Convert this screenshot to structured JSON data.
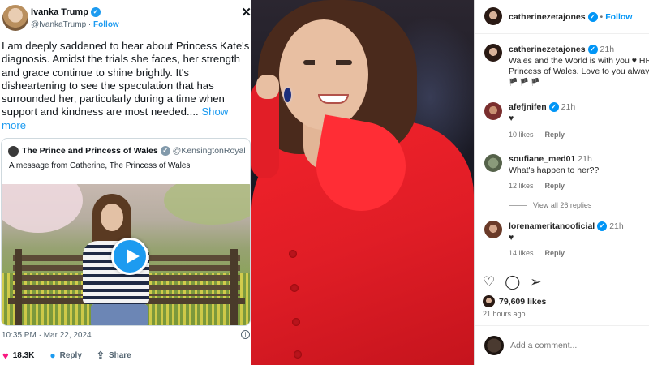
{
  "tweet": {
    "author": "Ivanka Trump",
    "handle": "@IvankaTrump",
    "separator": "·",
    "follow": "Follow",
    "close_icon": "✕",
    "body": "I am deeply saddened to hear about Princess Kate's diagnosis. Amidst the trials she faces, her strength and grace continue to shine brightly. It's disheartening to see the speculation that has surrounded her, particularly during a time when support and kindness are most needed.... ",
    "show_more": "Show more",
    "quote": {
      "author": "The Prince and Princess of Wales",
      "handle": "@KensingtonRoyal",
      "text": "A message from Catherine, The Princess of Wales"
    },
    "timestamp": "10:35 PM · Mar 22, 2024",
    "likes": "18.3K",
    "reply_label": "Reply",
    "share_label": "Share"
  },
  "instagram": {
    "header_user": "catherinezetajones",
    "follow": "Follow",
    "caption": {
      "user": "catherinezetajones",
      "time": "21h",
      "text_lines": [
        "Wales and the World is with you ♥ HRH",
        "Princess of Wales. Love to you always.",
        "🏴 🏴 🏴"
      ]
    },
    "comments": [
      {
        "user": "afefjnifen",
        "verified": true,
        "time": "21h",
        "text": "♥",
        "likes": "10 likes",
        "reply": "Reply"
      },
      {
        "user": "soufiane_med01",
        "verified": false,
        "time": "21h",
        "text": "What's happen to her??",
        "likes": "12 likes",
        "reply": "Reply"
      },
      {
        "user": "lorenameritanooficial",
        "verified": true,
        "time": "21h",
        "text": "♥",
        "likes": "14 likes",
        "reply": "Reply"
      }
    ],
    "view_replies": "View all 26 replies",
    "likes_count": "79,609 likes",
    "posted_ago": "21 hours ago",
    "comment_placeholder": "Add a comment..."
  },
  "colors": {
    "twitter_blue": "#1d9bf0",
    "like_pink": "#f91880",
    "ig_blue": "#0095f6",
    "coat_red": "#e01d26"
  },
  "icons": {
    "tweet": [
      "verified-icon",
      "close-icon",
      "play-icon",
      "info-icon",
      "heart-icon",
      "reply-icon",
      "share-icon"
    ],
    "instagram": [
      "verified-icon",
      "heart-icon",
      "comment-icon",
      "share-icon"
    ]
  }
}
